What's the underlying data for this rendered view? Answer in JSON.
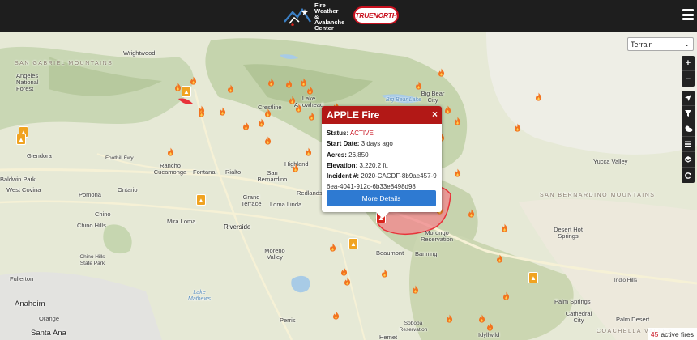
{
  "header": {
    "fwac_logo_text": "Fire Weather & Avalanche Center",
    "truenorth_logo_text": "TRUENORTH",
    "menu_icon": "hamburger-icon"
  },
  "map": {
    "layer_select": {
      "value": "Terrain",
      "options": [
        "Terrain"
      ]
    },
    "controls": {
      "zoom_in": "+",
      "zoom_out": "−",
      "icons": [
        "locate-icon",
        "filter-icon",
        "weather-icon",
        "list-icon",
        "layers-icon",
        "refresh-icon"
      ]
    },
    "places": [
      "Wrightwood",
      "SAN GABRIEL MOUNTAINS",
      "Angeles National Forest",
      "Crestline",
      "Lake Arrowhead",
      "Big Bear City",
      "Big Bear Lake",
      "Glendora",
      "Rancho Cucamonga",
      "Fontana",
      "Rialto",
      "San Bernardino",
      "Highland",
      "Redlands",
      "Baldwin Park",
      "West Covina",
      "Pomona",
      "Ontario",
      "Chino",
      "Chino Hills",
      "Grand Terrace",
      "Loma Linda",
      "Mira Loma",
      "Riverside",
      "Morongo Reservation",
      "Beaumont",
      "Banning",
      "Desert Hot Springs",
      "Yucca Valley",
      "SAN BERNARDINO MOUNTAINS",
      "Moreno Valley",
      "Lake Mathews",
      "Perris",
      "Hemet",
      "Soboba Reservation",
      "Idyllwild",
      "Palm Springs",
      "Cathedral City",
      "Indio Hills",
      "Palm Desert",
      "Fullerton",
      "Anaheim",
      "Orange",
      "Santa Ana",
      "COACHELLA VALLEY",
      "Foothill Fwy",
      "Chino Hills State Park"
    ],
    "popup": {
      "title": "APPLE Fire",
      "status_label": "Status:",
      "status_value": "ACTIVE",
      "start_label": "Start Date:",
      "start_value": "3 days ago",
      "acres_label": "Acres:",
      "acres_value": "26,850",
      "elevation_label": "Elevation:",
      "elevation_value": "3,220.2 ft.",
      "incident_label": "Incident #:",
      "incident_value": "2020-CACDF-8b9ae457-96ea-4041-912c-6b33e8498d98",
      "button_label": "More Details",
      "close_label": "×"
    },
    "active_fires": {
      "count": "45",
      "label": "active fires"
    },
    "colors": {
      "header_bg": "#1e1e1e",
      "popup_header": "#b21816",
      "button": "#2e7ad2",
      "fire_perimeter": "#e8333a",
      "status_active": "#c8101e"
    }
  }
}
